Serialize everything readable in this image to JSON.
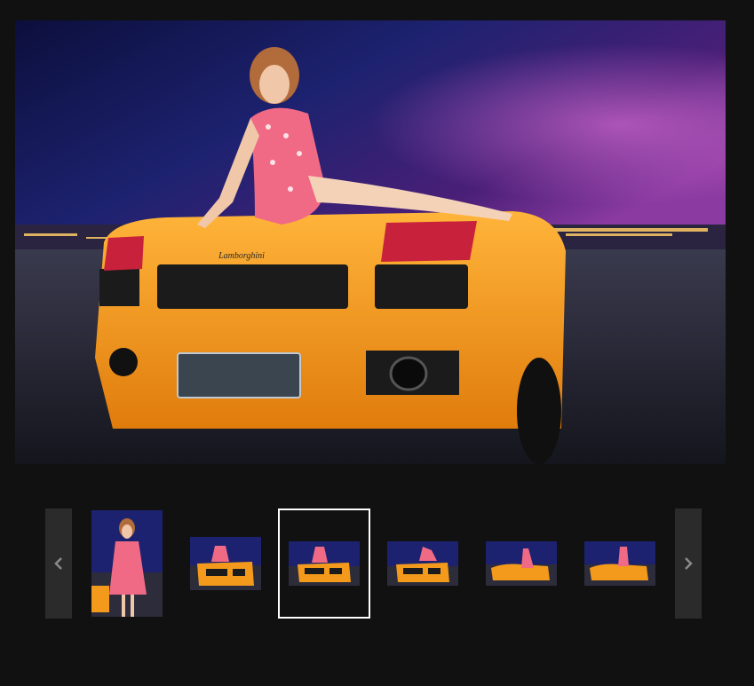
{
  "viewer": {
    "image_icon": "photo-lamborghini-night-scene",
    "brand_badge": "Lamborghini"
  },
  "thumbnails": {
    "selected_index": 2,
    "items": [
      {
        "kind": "portrait"
      },
      {
        "kind": "landscape"
      },
      {
        "kind": "landscape"
      },
      {
        "kind": "landscape"
      },
      {
        "kind": "landscape"
      },
      {
        "kind": "landscape"
      }
    ],
    "prev_icon": "chevron-left-icon",
    "next_icon": "chevron-right-icon"
  },
  "colors": {
    "background": "#111111",
    "nav_button": "#2b2b2b",
    "nav_arrow": "#8a8a8a",
    "selected_border": "#ffffff",
    "car_orange": "#f39a1c",
    "sky_blue": "#1c1e6e"
  }
}
